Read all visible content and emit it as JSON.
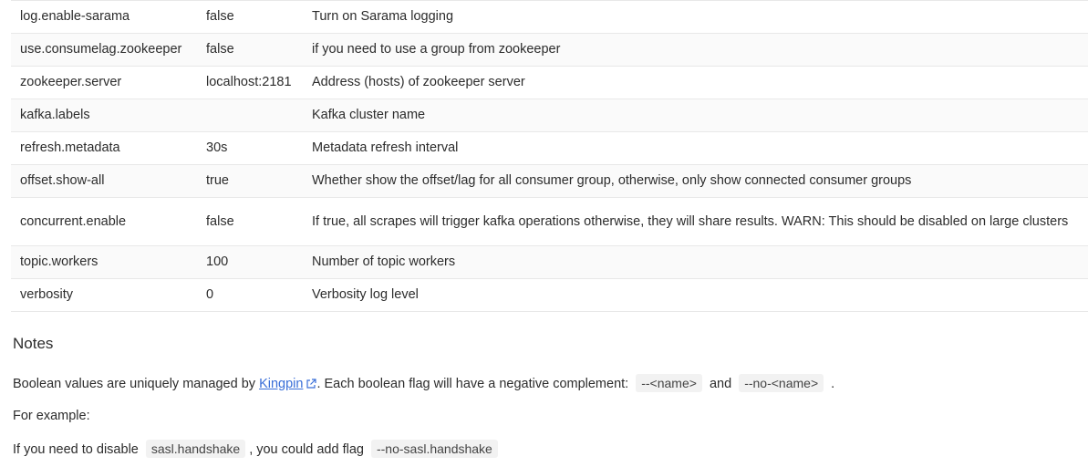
{
  "table": {
    "rows": [
      {
        "name": "log.enable-sarama",
        "default": "false",
        "description": "Turn on Sarama logging"
      },
      {
        "name": "use.consumelag.zookeeper",
        "default": "false",
        "description": "if you need to use a group from zookeeper"
      },
      {
        "name": "zookeeper.server",
        "default": "localhost:2181",
        "description": "Address (hosts) of zookeeper server"
      },
      {
        "name": "kafka.labels",
        "default": "",
        "description": "Kafka cluster name"
      },
      {
        "name": "refresh.metadata",
        "default": "30s",
        "description": "Metadata refresh interval"
      },
      {
        "name": "offset.show-all",
        "default": "true",
        "description": "Whether show the offset/lag for all consumer group, otherwise, only show connected consumer groups"
      },
      {
        "name": "concurrent.enable",
        "default": "false",
        "description": "If true, all scrapes will trigger kafka operations otherwise, they will share results. WARN: This should be disabled on large clusters"
      },
      {
        "name": "topic.workers",
        "default": "100",
        "description": "Number of topic workers"
      },
      {
        "name": "verbosity",
        "default": "0",
        "description": "Verbosity log level"
      }
    ]
  },
  "notes": {
    "heading": "Notes",
    "p1_before": "Boolean values are uniquely managed by ",
    "p1_link": "Kingpin",
    "p1_middle": ". Each boolean flag will have a negative complement: ",
    "p1_code1": "--<name>",
    "p1_and": " and ",
    "p1_code2": "--no-<name>",
    "p1_end": " .",
    "p2": "For example:",
    "p3_before": "If you need to disable ",
    "p3_code1": "sasl.handshake",
    "p3_middle": ", you could add flag ",
    "p3_code2": "--no-sasl.handshake"
  },
  "colors": {
    "link": "#3a6fd8",
    "code_bg": "#f2f2f2",
    "row_alt": "#fafafa",
    "border": "#e8e8e8"
  },
  "icons": {
    "external_link": "external-link-icon"
  }
}
